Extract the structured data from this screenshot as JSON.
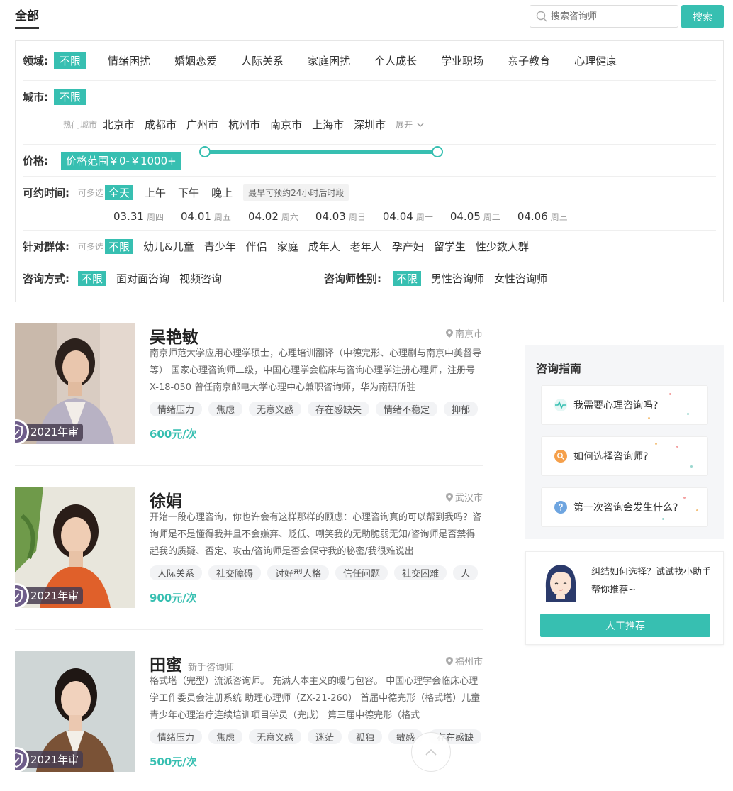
{
  "tabs": {
    "all": "全部"
  },
  "search": {
    "placeholder": "搜索咨询师",
    "button": "搜索"
  },
  "filters": {
    "domain": {
      "label": "领域:",
      "options": [
        "不限",
        "情绪困扰",
        "婚姻恋爱",
        "人际关系",
        "家庭困扰",
        "个人成长",
        "学业职场",
        "亲子教育",
        "心理健康"
      ]
    },
    "city": {
      "label": "城市:",
      "selected": "不限",
      "hot_label": "热门城市",
      "options": [
        "北京市",
        "成都市",
        "广州市",
        "杭州市",
        "南京市",
        "上海市",
        "深圳市"
      ],
      "expand": "展开"
    },
    "price": {
      "label": "价格:",
      "range": "价格范围￥0-￥1000+",
      "min_fraction": 0.0,
      "max_fraction": 1.0
    },
    "time": {
      "label": "可约时间:",
      "multi": "可多选",
      "options": [
        "全天",
        "上午",
        "下午",
        "晚上"
      ],
      "tip": "最早可预约24小时后时段",
      "dates": [
        {
          "date": "03.31",
          "weekday": "周四"
        },
        {
          "date": "04.01",
          "weekday": "周五"
        },
        {
          "date": "04.02",
          "weekday": "周六"
        },
        {
          "date": "04.03",
          "weekday": "周日"
        },
        {
          "date": "04.04",
          "weekday": "周一"
        },
        {
          "date": "04.05",
          "weekday": "周二"
        },
        {
          "date": "04.06",
          "weekday": "周三"
        }
      ]
    },
    "group": {
      "label": "针对群体:",
      "multi": "可多选",
      "options": [
        "不限",
        "幼儿&儿童",
        "青少年",
        "伴侣",
        "家庭",
        "成年人",
        "老年人",
        "孕产妇",
        "留学生",
        "性少数人群"
      ]
    },
    "method": {
      "label": "咨询方式:",
      "options": [
        "不限",
        "面对面咨询",
        "视频咨询"
      ]
    },
    "gender": {
      "label": "咨询师性别:",
      "options": [
        "不限",
        "男性咨询师",
        "女性咨询师"
      ]
    }
  },
  "counselors": [
    {
      "name": "吴艳敏",
      "newbie": "",
      "city": "南京市",
      "bio": "南京师范大学应用心理学硕士，心理培训翻译（中德完形、心理剧与南京中美督导等） 国家心理咨询师二级，中国心理学会临床与咨询心理学注册心理师，注册号X-18-050 曾任南京邮电大学心理中心兼职咨询师，华为南研所驻",
      "tags": [
        "情绪压力",
        "焦虑",
        "无意义感",
        "存在感缺失",
        "情绪不稳定",
        "抑郁"
      ],
      "price": "600元/次",
      "badge": "2021年审"
    },
    {
      "name": "徐娟",
      "newbie": "",
      "city": "武汉市",
      "bio": "开始一段心理咨询，你也许会有这样那样的顾虑：心理咨询真的可以帮到我吗？咨询师是不是懂得我并且不会嫌弃、贬低、嘲笑我的无助脆弱无知/咨询师是否禁得起我的质疑、否定、攻击/咨询师是否会保守我的秘密/我很难说出",
      "tags": [
        "人际关系",
        "社交障碍",
        "讨好型人格",
        "信任问题",
        "社交困难",
        "人"
      ],
      "price": "900元/次",
      "badge": "2021年审"
    },
    {
      "name": "田蜜",
      "newbie": "新手咨询师",
      "city": "福州市",
      "bio": "格式塔（完型）流派咨询师。 充满人本主义的暖与包容。 中国心理学会临床心理学工作委员会注册系统 助理心理师（ZX-21-260） 首届中德完形（格式塔）儿童青少年心理治疗连续培训项目学员（完成） 第三届中德完形（格式",
      "tags": [
        "情绪压力",
        "焦虑",
        "无意义感",
        "迷茫",
        "孤独",
        "敏感",
        "存在感缺"
      ],
      "price": "500元/次",
      "badge": "2021年审"
    }
  ],
  "guide": {
    "title": "咨询指南",
    "items": [
      "我需要心理咨询吗?",
      "如何选择咨询师?",
      "第一次咨询会发生什么?"
    ]
  },
  "recommend": {
    "text": "纠结如何选择？试试找小助手帮你推荐~",
    "button": "人工推荐"
  },
  "colors": {
    "accent": "#37bfb1"
  },
  "icons": [
    "search-icon",
    "location-icon",
    "chevron-down-icon",
    "shield-check-icon",
    "pulse-icon",
    "magnifier-icon",
    "question-icon",
    "assistant-avatar-icon",
    "chevron-up-icon"
  ]
}
